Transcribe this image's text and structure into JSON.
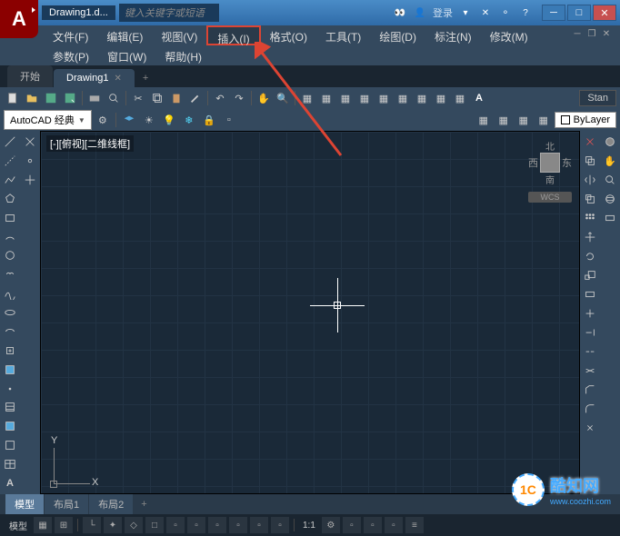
{
  "titlebar": {
    "doc": "Drawing1.d...",
    "search_placeholder": "键入关键字或短语",
    "login": "登录"
  },
  "menu": {
    "file": "文件(F)",
    "edit": "编辑(E)",
    "view": "视图(V)",
    "insert": "插入(I)",
    "format": "格式(O)",
    "tools": "工具(T)",
    "draw": "绘图(D)",
    "annotate": "标注(N)",
    "modify": "修改(M)",
    "param": "参数(P)",
    "window": "窗口(W)",
    "help": "帮助(H)"
  },
  "tabs": {
    "start": "开始",
    "drawing": "Drawing1"
  },
  "toolbar2": {
    "workspace": "AutoCAD 经典",
    "bylayer": "ByLayer",
    "stan": "Stan"
  },
  "canvas": {
    "view_label": "[-][俯视][二维线框]",
    "wcs": "WCS",
    "n": "北",
    "s": "南",
    "e": "东",
    "w": "西",
    "x": "X",
    "y": "Y"
  },
  "modeltabs": {
    "model": "模型",
    "layout1": "布局1",
    "layout2": "布局2"
  },
  "status": {
    "model": "模型",
    "scale": "1:1"
  },
  "watermark": {
    "logo": "1C",
    "text": "酷知网",
    "site": "www.coozhi.com"
  }
}
